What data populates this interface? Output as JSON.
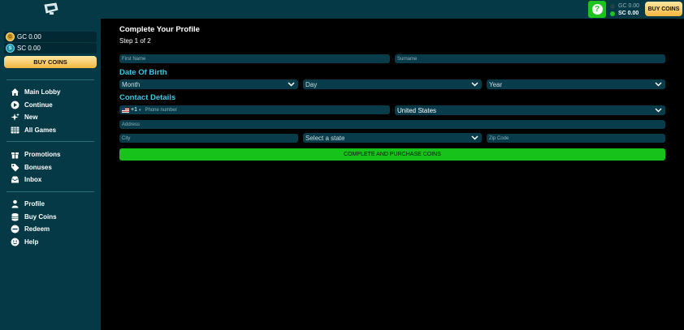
{
  "header": {
    "help_label": "?",
    "balance_gc": "GC 0.00",
    "balance_sc": "SC 0.00",
    "buy_label": "BUY COINS",
    "colors": {
      "bg": "#053946",
      "help": "#1ec41e",
      "gold": "#f2b640"
    }
  },
  "sidebar": {
    "gc_balance": "GC 0.00",
    "sc_balance": "SC 0.00",
    "buy_label": "BUY COINS",
    "groups": [
      [
        {
          "label": "Main Lobby",
          "icon": "home-icon"
        },
        {
          "label": "Continue",
          "icon": "play-icon"
        },
        {
          "label": "New",
          "icon": "sparkle-icon"
        },
        {
          "label": "All Games",
          "icon": "grid-icon"
        }
      ],
      [
        {
          "label": "Promotions",
          "icon": "gift-icon"
        },
        {
          "label": "Bonuses",
          "icon": "tag-icon"
        },
        {
          "label": "Inbox",
          "icon": "inbox-icon"
        }
      ],
      [
        {
          "label": "Profile",
          "icon": "user-icon"
        },
        {
          "label": "Buy Coins",
          "icon": "coins-icon"
        },
        {
          "label": "Redeem",
          "icon": "redeem-icon"
        },
        {
          "label": "Help",
          "icon": "help-icon"
        }
      ]
    ]
  },
  "main": {
    "title": "Complete Your Profile",
    "step": "Step 1 of 2",
    "first_name_placeholder": "First Name",
    "surname_placeholder": "Surname",
    "dob_heading": "Date Of Birth",
    "month": "Month",
    "day": "Day",
    "year": "Year",
    "contact_heading": "Contact Details",
    "phone_code": "+1",
    "phone_placeholder": "Phone number",
    "country": "United States",
    "address_placeholder": "Address",
    "city_placeholder": "City",
    "state": "Select a state",
    "zip_placeholder": "Zip Code",
    "submit_label": "COMPLETE AND PURCHASE COINS",
    "colors": {
      "field": "#083c4a",
      "heading": "#39c9e6",
      "submit": "#17c21a"
    }
  }
}
